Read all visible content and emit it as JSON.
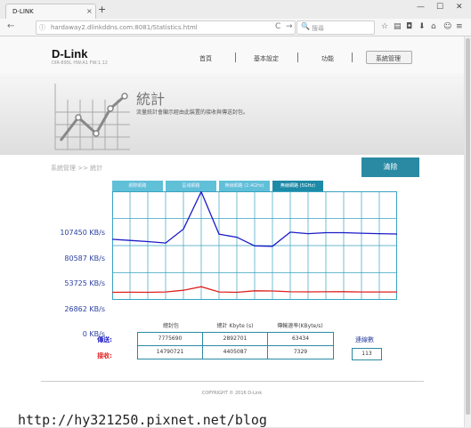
{
  "browser": {
    "tab_title": "D-LINK",
    "tab_close": "×",
    "new_tab": "+",
    "url": "hardaway2.dlinkddns.com:8081/Statistics.html",
    "search_placeholder": "搜尋",
    "min": "—",
    "max": "☐",
    "close": "✕",
    "back": "←",
    "info": "ⓘ",
    "reload": "C",
    "go": "→",
    "search_glyph": "🔍"
  },
  "header": {
    "logo": "D-Link",
    "model": "DIR-895L HW:A1 FW:1.12",
    "menu": [
      "首頁",
      "基本設定",
      "功能",
      "系統管理"
    ]
  },
  "banner": {
    "title": "統計",
    "description": "流量統計會顯示經由此裝置的接收與傳送封包。"
  },
  "breadcrumb": "系統管理 >> 統計",
  "clear_button": "清除",
  "chart_tabs": [
    "網際網路",
    "區域網路",
    "無線網路 (2.4GHz)",
    "無線網路 (5GHz)"
  ],
  "chart_data": {
    "type": "line",
    "y_tick_labels": [
      "107450 KB/s",
      "80587 KB/s",
      "53725 KB/s",
      "26862 KB/s",
      "0 KB/s"
    ],
    "ylim": [
      0,
      107450
    ],
    "grid": true,
    "series": [
      {
        "color": "#1a1ac8",
        "values": [
          60000,
          58800,
          57700,
          56300,
          70000,
          107000,
          65000,
          62000,
          53500,
          53000,
          67000,
          65500,
          66500,
          66500,
          66000,
          65500,
          65200
        ]
      },
      {
        "color": "#e02020",
        "values": [
          7500,
          7600,
          7500,
          7800,
          9500,
          13000,
          7800,
          7500,
          9000,
          8800,
          8000,
          7900,
          8000,
          8100,
          7800,
          7800,
          7800
        ]
      }
    ]
  },
  "stats": {
    "headers": [
      "總封包",
      "總計 Kbyte (s)",
      "傳輸速率(KByte/s)"
    ],
    "rows": [
      {
        "label": "傳送:",
        "color": "#1a1ac8",
        "values": [
          "7775690",
          "2892701",
          "63434"
        ]
      },
      {
        "label": "接收:",
        "color": "#e02020",
        "values": [
          "14790721",
          "4405087",
          "7329"
        ]
      }
    ],
    "connections_label": "連線數",
    "connections": "113"
  },
  "footer": "COPYRIGHT © 2016 D-Link",
  "watermark": "http://hy321250.pixnet.net/blog"
}
